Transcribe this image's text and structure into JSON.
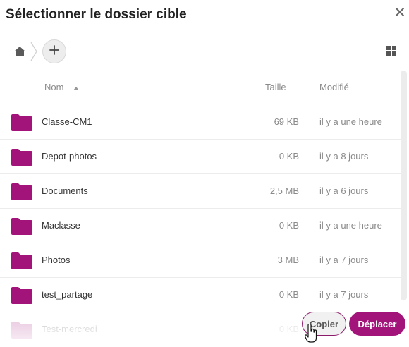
{
  "dialog": {
    "title": "Sélectionner le dossier cible",
    "close_icon": "close-icon"
  },
  "breadcrumb": {
    "home_icon": "home-icon",
    "add_icon": "plus-icon"
  },
  "view_toggle": {
    "icon": "grid-view-icon"
  },
  "columns": {
    "name": "Nom",
    "size": "Taille",
    "modified": "Modifié",
    "sort_icon": "sort-ascending-icon"
  },
  "colors": {
    "folder": "#a3147b",
    "primary": "#a3147b"
  },
  "files": [
    {
      "name": "Classe-CM1",
      "size": "69 KB",
      "modified": "il y a une heure",
      "icon": "folder-icon"
    },
    {
      "name": "Depot-photos",
      "size": "0 KB",
      "modified": "il y a 8 jours",
      "icon": "folder-icon"
    },
    {
      "name": "Documents",
      "size": "2,5 MB",
      "modified": "il y a 6 jours",
      "icon": "folder-icon"
    },
    {
      "name": "Maclasse",
      "size": "0 KB",
      "modified": "il y a une heure",
      "icon": "folder-icon"
    },
    {
      "name": "Photos",
      "size": "3 MB",
      "modified": "il y a 7 jours",
      "icon": "folder-icon"
    },
    {
      "name": "test_partage",
      "size": "0 KB",
      "modified": "il y a 7 jours",
      "icon": "folder-icon"
    },
    {
      "name": "Test-mercredi",
      "size": "0 KB",
      "modified": "",
      "icon": "folder-icon"
    }
  ],
  "actions": {
    "copy_label": "Copier",
    "move_label": "Déplacer"
  }
}
